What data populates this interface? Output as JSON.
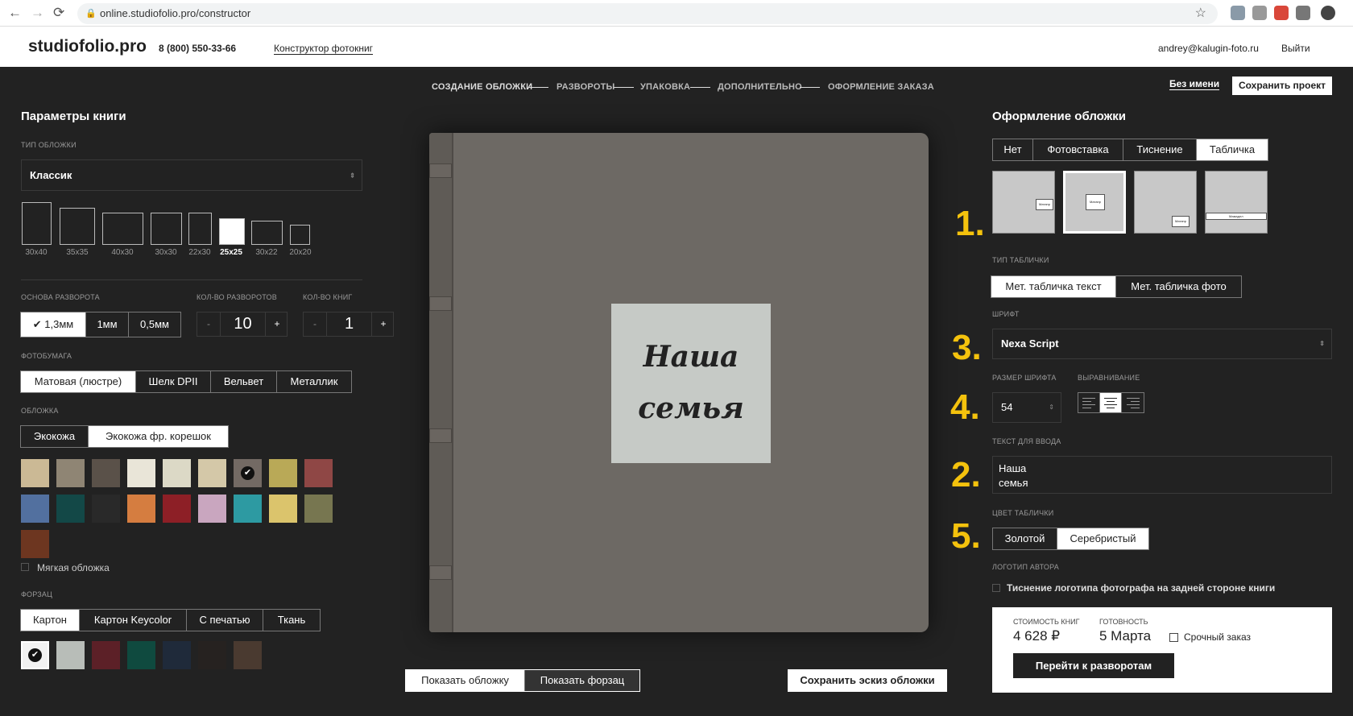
{
  "browser": {
    "url": "online.studiofolio.pro/constructor",
    "back": "←",
    "fwd": "→",
    "reload": "⟳",
    "star": "☆"
  },
  "header": {
    "logo": "studiofolio.pro",
    "phone": "8 (800) 550-33-66",
    "link": "Конструктор фотокниг",
    "email": "andrey@kalugin-foto.ru",
    "exit": "Выйти"
  },
  "steps": [
    "СОЗДАНИЕ ОБЛОЖКИ",
    "РАЗВОРОТЫ",
    "УПАКОВКА",
    "ДОПОЛНИТЕЛЬНО",
    "ОФОРМЛЕНИЕ ЗАКАЗА"
  ],
  "project": {
    "name": "Без имени",
    "save": "Сохранить проект"
  },
  "left": {
    "title": "Параметры книги",
    "cover_type_label": "ТИП ОБЛОЖКИ",
    "cover_type": "Классик",
    "formats": [
      "30x40",
      "35x35",
      "40x30",
      "30x30",
      "22x30",
      "25x25",
      "30x22",
      "20x20"
    ],
    "base_label": "ОСНОВА РАЗВОРОТА",
    "base": [
      "1,3мм",
      "1мм",
      "0,5мм"
    ],
    "spreads_label": "КОЛ-ВО РАЗВОРОТОВ",
    "spreads": "10",
    "books_label": "КОЛ-ВО КНИГ",
    "books": "1",
    "minus": "-",
    "plus": "+",
    "paper_label": "ФОТОБУМАГА",
    "paper": [
      "Матовая (люстре)",
      "Шелк DPII",
      "Вельвет",
      "Металлик"
    ],
    "cover_label": "ОБЛОЖКА",
    "cover": [
      "Экокожа",
      "Экокожа фр. корешок"
    ],
    "colors": [
      "#cbb995",
      "#8f8574",
      "#5a5149",
      "#e9e5d8",
      "#dcd9c6",
      "#d4c8a8",
      "#736a64",
      "#b9a957",
      "#8f4745",
      "#52709f",
      "#134847",
      "#292929",
      "#d57d40",
      "#8d1f26",
      "#c9a6bf",
      "#2d9aa2",
      "#dbc46c",
      "#777650",
      "#6d3620"
    ],
    "soft_cover": "Мягкая обложка",
    "endpaper_label": "ФОРЗАЦ",
    "endpaper": [
      "Картон",
      "Картон Keycolor",
      "С печатью",
      "Ткань"
    ],
    "endpaper_colors": [
      "#f2f2f2",
      "#b8bdb8",
      "#5c2027",
      "#0f4a3f",
      "#1f2a3a",
      "#262220",
      "#4a3a30"
    ]
  },
  "center": {
    "plate_text_1": "Наша",
    "plate_text_2": "семья",
    "show_cover": "Показать обложку",
    "show_endpaper": "Показать форзац",
    "save_sketch": "Сохранить эскиз обложки"
  },
  "right": {
    "title": "Оформление обложки",
    "tabs": [
      "Нет",
      "Фотовставка",
      "Тиснение",
      "Табличка"
    ],
    "thumb_labels": [
      "Матапр",
      "Матапр",
      "Матапр",
      "Мамадлл"
    ],
    "num1": "1.",
    "num2": "2.",
    "num3": "3.",
    "num4": "4.",
    "num5": "5.",
    "plate_type_label": "ТИП ТАБЛИЧКИ",
    "plate_types": [
      "Мет. табличка текст",
      "Мет. табличка фото"
    ],
    "font_label": "ШРИФТ",
    "font": "Nexa Script",
    "size_label": "РАЗМЕР ШРИФТА",
    "size": "54",
    "align_label": "ВЫРАВНИВАНИЕ",
    "text_label": "ТЕКСТ ДЛЯ ВВОДА",
    "text_line1": "Наша",
    "text_line2": "семья",
    "color_label": "ЦВЕТ ТАБЛИЧКИ",
    "plate_colors": [
      "Золотой",
      "Серебристый"
    ],
    "logo_label": "ЛОГОТИП АВТОРА",
    "logo_option": "Тиснение логотипа фотографа на задней стороне книги",
    "price_label": "СТОИМОСТЬ КНИГ",
    "price": "4 628 ₽",
    "ready_label": "ГОТОВНОСТЬ",
    "ready": "5 Марта",
    "urgent": "Срочный заказ",
    "next": "Перейти к разворотам"
  }
}
